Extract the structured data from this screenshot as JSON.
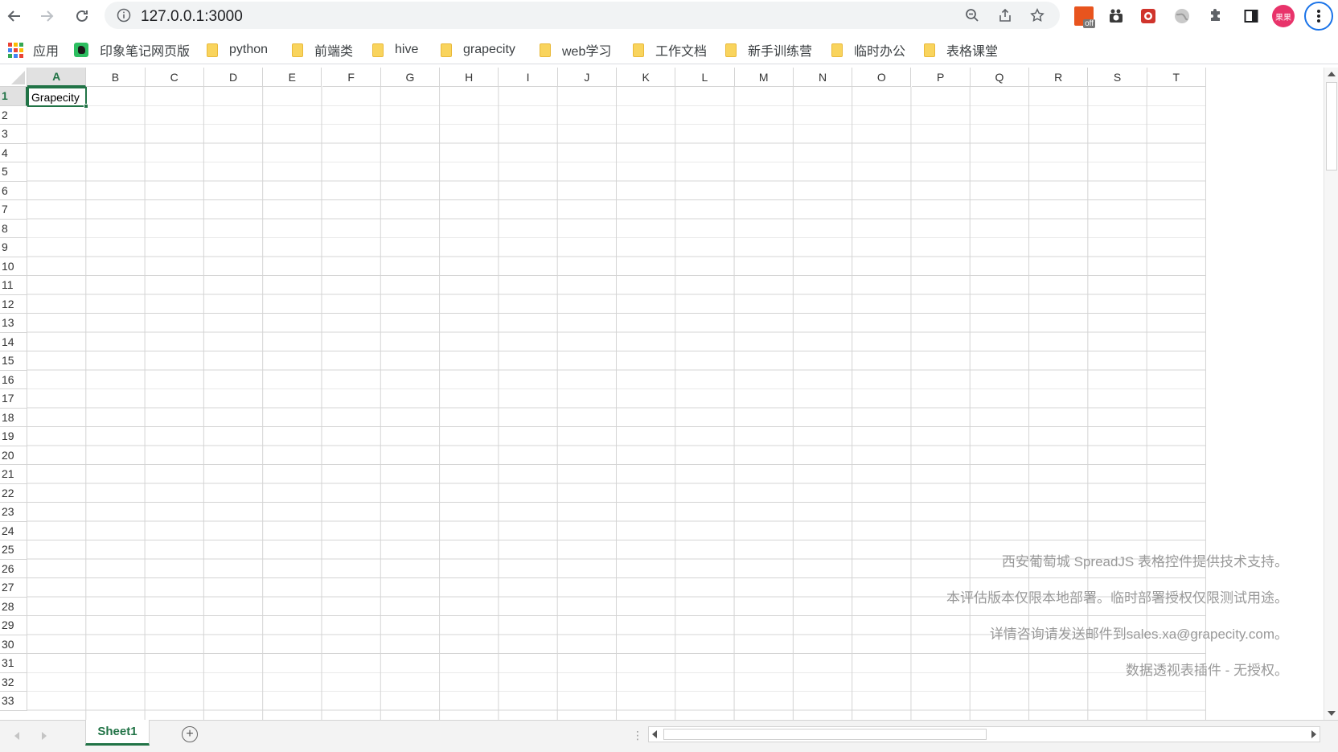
{
  "browser": {
    "url": "127.0.0.1:3000",
    "profile_label": "果果",
    "extension_badge": "off"
  },
  "bookmarks": {
    "apps_label": "应用",
    "items": [
      {
        "label": "印象笔记网页版",
        "icon": "evernote-icon"
      },
      {
        "label": "python",
        "icon": "folder-icon"
      },
      {
        "label": "前端类",
        "icon": "folder-icon"
      },
      {
        "label": "hive",
        "icon": "folder-icon"
      },
      {
        "label": "grapecity",
        "icon": "folder-icon"
      },
      {
        "label": "web学习",
        "icon": "folder-icon"
      },
      {
        "label": "工作文档",
        "icon": "folder-icon"
      },
      {
        "label": "新手训练营",
        "icon": "folder-icon"
      },
      {
        "label": "临时办公",
        "icon": "folder-icon"
      },
      {
        "label": "表格课堂",
        "icon": "folder-icon"
      }
    ]
  },
  "spreadsheet": {
    "columns": [
      "A",
      "B",
      "C",
      "D",
      "E",
      "F",
      "G",
      "H",
      "I",
      "J",
      "K",
      "L",
      "M",
      "N",
      "O",
      "P",
      "Q",
      "R",
      "S",
      "T"
    ],
    "rows": [
      "1",
      "2",
      "3",
      "4",
      "5",
      "6",
      "7",
      "8",
      "9",
      "10",
      "11",
      "12",
      "13",
      "14",
      "15",
      "16",
      "17",
      "18",
      "19",
      "20",
      "21",
      "22",
      "23",
      "24",
      "25",
      "26",
      "27",
      "28",
      "29",
      "30",
      "31",
      "32",
      "33"
    ],
    "active_cell": "A1",
    "cell_a1": "Grapecity",
    "accent_color": "#217346"
  },
  "watermark": {
    "line1": "西安葡萄城 SpreadJS 表格控件提供技术支持。",
    "line2": "本评估版本仅限本地部署。临时部署授权仅限测试用途。",
    "line3": "详情咨询请发送邮件到sales.xa@grapecity.com。",
    "line4": "数据透视表插件 - 无授权。"
  },
  "tabs": {
    "sheet_name": "Sheet1",
    "add_label": "+"
  }
}
